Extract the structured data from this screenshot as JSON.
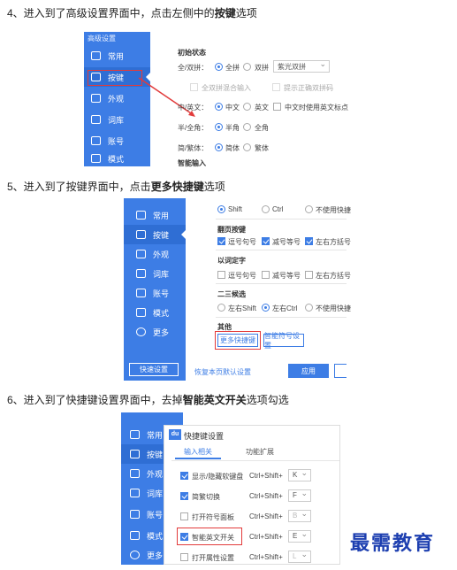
{
  "steps": [
    {
      "prefix": "4、进入到了高级设置界面中，点击左侧中的",
      "bold": "按键",
      "suffix": "选项"
    },
    {
      "prefix": "5、进入到了按键界面中，点击",
      "bold": "更多快捷键",
      "suffix": "选项"
    },
    {
      "prefix": "6、进入到了快捷键设置界面中，去掉",
      "bold": "智能英文开关",
      "suffix": "选项勾选"
    }
  ],
  "shot1": {
    "sidebar_title": "高级设置",
    "sidebar": [
      "常用",
      "按键",
      "外观",
      "词库",
      "账号",
      "模式"
    ],
    "section_title": "初始状态",
    "rows": [
      {
        "label": "全/双拼：",
        "opt1": "全拼",
        "opt2": "双拼",
        "select": "紫光双拼"
      },
      {
        "label": "中/英文：",
        "opt1": "中文",
        "opt2": "英文",
        "extra": "中文时使用英文标点"
      },
      {
        "label": "半/全角：",
        "opt1": "半角",
        "opt2": "全角"
      },
      {
        "label": "简/繁体：",
        "opt1": "简体",
        "opt2": "繁体"
      }
    ],
    "dim_check1": "全双拼混合输入",
    "dim_check2": "提示正确双拼码",
    "section2_title": "智能输入"
  },
  "shot2": {
    "sidebar": [
      "常用",
      "按键",
      "外观",
      "词库",
      "账号",
      "模式",
      "更多"
    ],
    "top_opts": [
      "Shift",
      "Ctrl",
      "不使用快捷"
    ],
    "page_title": "翻页按键",
    "page_opts": [
      "逗号句号",
      "减号等号",
      "左右方括号"
    ],
    "word_title": "以词定字",
    "word_opts": [
      "逗号句号",
      "减号等号",
      "左右方括号"
    ],
    "candidate_title": "二三候选",
    "candidate_opts": [
      "左右Shift",
      "左右Ctrl",
      "不使用快捷"
    ],
    "other_title": "其他",
    "more_btn": "更多快捷键",
    "symbol_btn": "智能符号设置",
    "quick_btn": "快速设置",
    "restore_link": "恢复本页默认设置",
    "apply_btn": "应用"
  },
  "shot3": {
    "sidebar": [
      "常用",
      "按键",
      "外观",
      "词库",
      "账号",
      "模式",
      "更多"
    ],
    "logo": "du",
    "title": "快捷键设置",
    "tab1": "输入相关",
    "tab2": "功能扩展",
    "items": [
      {
        "label": "显示/隐藏软键盘",
        "key": "K",
        "checked": true
      },
      {
        "label": "简繁切换",
        "key": "F",
        "checked": true
      },
      {
        "label": "打开符号面板",
        "key": "B",
        "checked": false
      },
      {
        "label": "智能英文开关",
        "key": "E",
        "checked": true
      },
      {
        "label": "打开属性设置",
        "key": "L",
        "checked": false
      }
    ],
    "combo": "Ctrl+Shift+"
  },
  "watermark": "最需教育",
  "colors": {
    "accent": "#3d7de5",
    "highlight": "#e23b3b"
  }
}
